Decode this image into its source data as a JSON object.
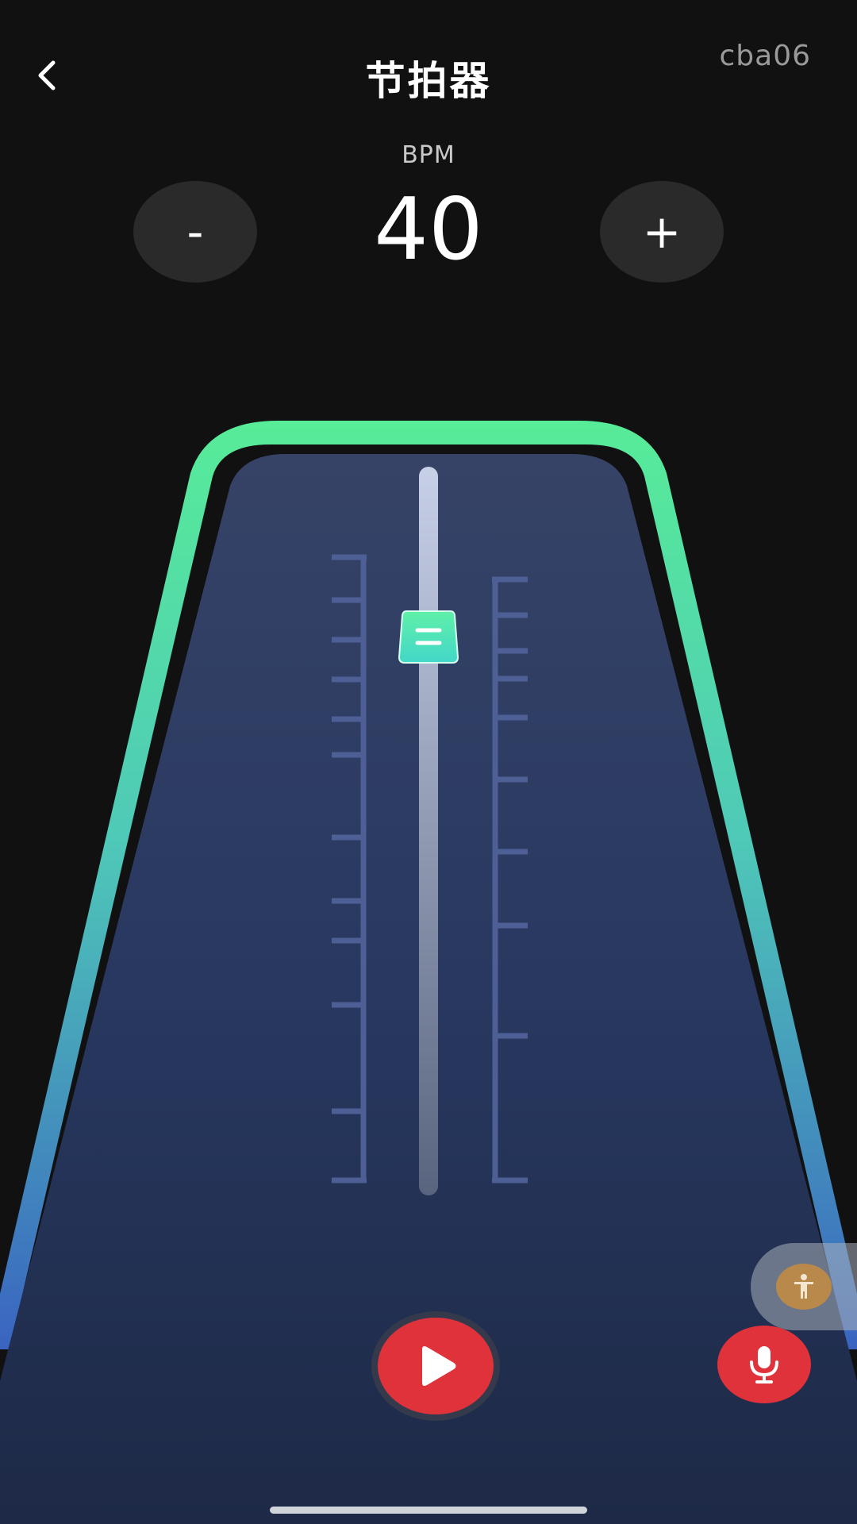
{
  "header": {
    "title": "节拍器",
    "corner_tag": "cba06"
  },
  "bpm": {
    "label": "BPM",
    "value": "40",
    "minus_label": "-",
    "plus_label": "+"
  },
  "icons": {
    "back": "chevron-left-icon",
    "play": "play-icon",
    "mic": "microphone-icon",
    "accessibility": "accessibility-icon"
  },
  "colors": {
    "frame_top": "#57ec98",
    "frame_bottom": "#3a6cc4",
    "body_top": "#354265",
    "body_bottom": "#1e2b4c",
    "weight": "#4fe5b7",
    "accent_red": "#e0323b"
  }
}
